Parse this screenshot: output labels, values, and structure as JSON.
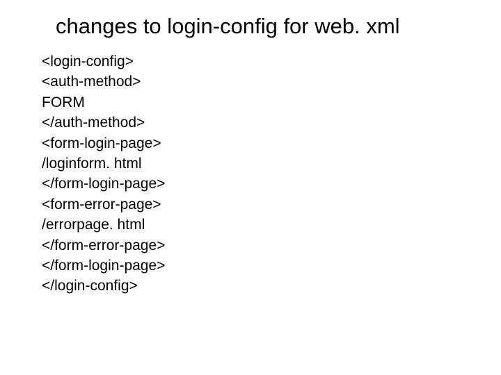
{
  "title": "changes to login-config for web. xml",
  "code": {
    "lines": [
      "<login-config>",
      "<auth-method>",
      "FORM",
      "</auth-method>",
      "<form-login-page>",
      "/loginform. html",
      "</form-login-page>",
      "<form-error-page>",
      "/errorpage. html",
      "</form-error-page>",
      "</form-login-page>",
      "</login-config>"
    ]
  }
}
